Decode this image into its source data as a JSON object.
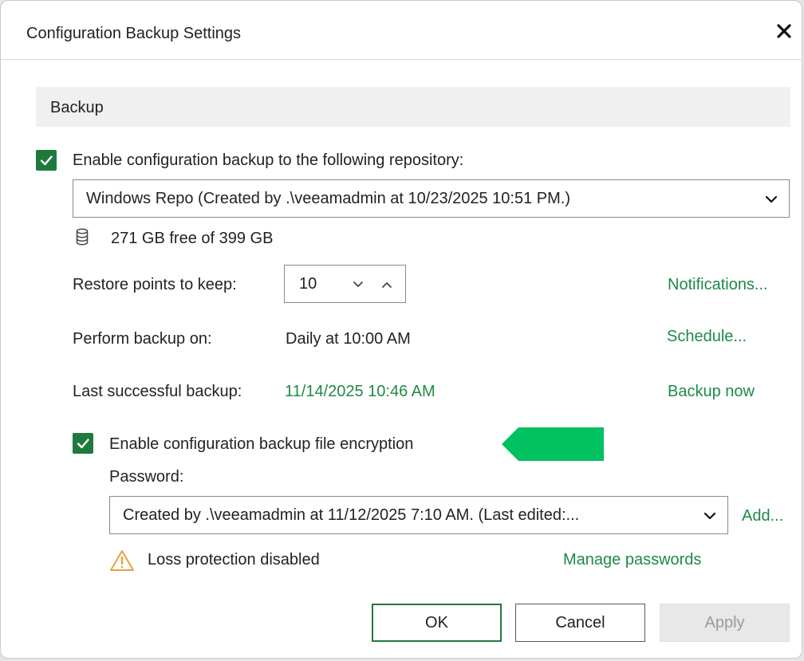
{
  "dialog": {
    "title": "Configuration Backup Settings"
  },
  "section": {
    "header": "Backup"
  },
  "backup": {
    "enable_label": "Enable configuration backup to the following repository:",
    "enable_checked": true,
    "repository_value": "Windows Repo (Created by .\\veeamadmin at 10/23/2025 10:51 PM.)",
    "storage_text": "271 GB free of 399 GB",
    "restore_points_label": "Restore points to keep:",
    "restore_points_value": "10",
    "notifications_link": "Notifications...",
    "perform_label": "Perform backup on:",
    "perform_value": "Daily at 10:00 AM",
    "schedule_link": "Schedule...",
    "last_label": "Last successful backup:",
    "last_value": "11/14/2025 10:46 AM",
    "backup_now_link": "Backup now"
  },
  "encryption": {
    "enable_label": "Enable configuration backup file encryption",
    "enable_checked": true,
    "password_label": "Password:",
    "password_value": "Created by .\\veeamadmin at 11/12/2025 7:10 AM. (Last edited:...",
    "add_link": "Add...",
    "warning_text": "Loss protection disabled",
    "manage_link": "Manage passwords"
  },
  "buttons": {
    "ok": "OK",
    "cancel": "Cancel",
    "apply": "Apply"
  },
  "colors": {
    "accent_green": "#1e7a3c",
    "link_green": "#1e8a45",
    "marker_green": "#00c060",
    "warning_orange": "#e8a33d"
  },
  "icons": [
    "close-icon",
    "checkmark-icon",
    "chevron-down-icon",
    "chevron-up-icon",
    "database-icon",
    "warning-icon"
  ]
}
